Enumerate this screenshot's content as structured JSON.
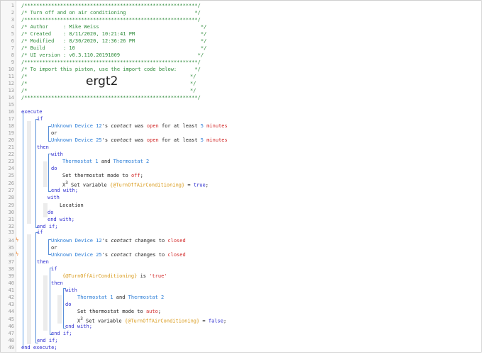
{
  "header": {
    "star_line": "/**********************************************************/",
    "title_line": "/* Turn off and on air conditioning                       */",
    "author": "/* Author     : Mike Weiss                                  */",
    "created": "/* Created    : 8/11/2020, 10:21:41 PM                      */",
    "modified": "/* Modified   : 8/30/2020, 12:36:26 PM                      */",
    "build": "/* Build      : 10                                          */",
    "ui_version": "/* UI version : v0.3.110.20191009                          */",
    "import_line": "/* To import this piston, use the import code below:      */",
    "blank_comment_open": "/*",
    "blank_comment_close": "*/",
    "import_code": "ergt2"
  },
  "code": {
    "execute": "execute",
    "if": "if",
    "then": "then",
    "or": "or",
    "with": "with",
    "do": "do",
    "end_with": "end with;",
    "end_if": "end if;",
    "end_execute": "end execute;",
    "device12": "Unknown Device 12",
    "device25": "Unknown Device 25",
    "contact_s": "'s ",
    "contact": "contact",
    "was": " was ",
    "open": "open",
    "for_at_least": " for at least ",
    "five": "5",
    "minutes": " minutes",
    "changes_to": " changes to ",
    "closed": "closed",
    "thermostat1": "Thermostat 1",
    "and": " and ",
    "thermostat2": "Thermostat 2",
    "set_mode_off_a": "Set thermostat mode to ",
    "off": "off",
    "auto": "auto",
    "semicolon": ";",
    "x_icon": "X",
    "x_sup": "3",
    "set_variable": " Set variable ",
    "var_name": "{@TurnOffAirConditioning}",
    "eq": " = ",
    "true": "true",
    "false": "false",
    "location": "Location",
    "is": " is ",
    "true_str": "'true'"
  },
  "line_numbers": [
    "1",
    "2",
    "3",
    "4",
    "5",
    "6",
    "7",
    "8",
    "9",
    "10",
    "11",
    "12",
    "13",
    "14",
    "15",
    "16",
    "17",
    "18",
    "19",
    "20",
    "21",
    "22",
    "23",
    "24",
    "25",
    "26",
    "27",
    "28",
    "29",
    "30",
    "31",
    "32",
    "33",
    "34",
    "35",
    "36",
    "37",
    "38",
    "39",
    "40",
    "41",
    "42",
    "43",
    "44",
    "45",
    "46",
    "47",
    "48",
    "49"
  ]
}
